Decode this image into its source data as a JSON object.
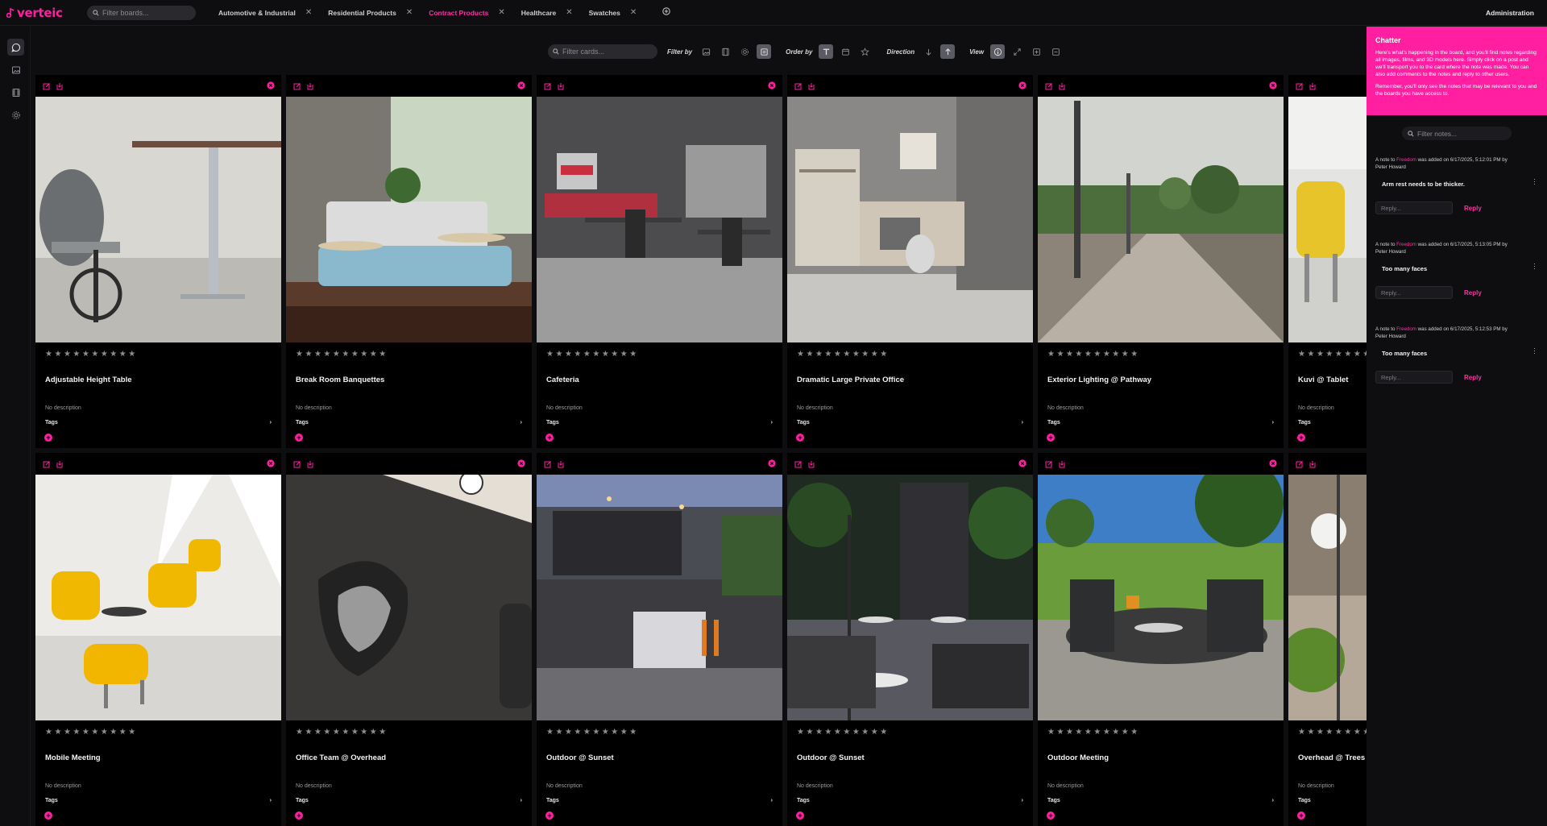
{
  "app": {
    "logo_text": "verteic",
    "brand_color": "#ff1fa0",
    "board_search_placeholder": "Filter boards...",
    "admin_label": "Administration"
  },
  "tabs": [
    {
      "label": "Automotive & Industrial",
      "active": false
    },
    {
      "label": "Residential Products",
      "active": false
    },
    {
      "label": "Contract Products",
      "active": true
    },
    {
      "label": "Healthcare",
      "active": false
    },
    {
      "label": "Swatches",
      "active": false
    }
  ],
  "toolbar": {
    "card_search_placeholder": "Filter cards...",
    "filter_by": "Filter by",
    "order_by": "Order by",
    "direction": "Direction",
    "view": "View"
  },
  "cards": [
    {
      "title": "Adjustable Height Table",
      "description": "No description",
      "tags_label": "Tags",
      "rating": 0
    },
    {
      "title": "Break Room Banquettes",
      "description": "No description",
      "tags_label": "Tags",
      "rating": 0
    },
    {
      "title": "Cafeteria",
      "description": "No description",
      "tags_label": "Tags",
      "rating": 0
    },
    {
      "title": "Dramatic Large Private Office",
      "description": "No description",
      "tags_label": "Tags",
      "rating": 0
    },
    {
      "title": "Exterior Lighting @ Pathway",
      "description": "No description",
      "tags_label": "Tags",
      "rating": 0
    },
    {
      "title": "Kuvi @ Tablet",
      "description": "No description",
      "tags_label": "Tags",
      "rating": 0
    },
    {
      "title": "Mobile Meeting",
      "description": "No description",
      "tags_label": "Tags",
      "rating": 0
    },
    {
      "title": "Office Team @ Overhead",
      "description": "No description",
      "tags_label": "Tags",
      "rating": 0
    },
    {
      "title": "Outdoor @ Sunset",
      "description": "No description",
      "tags_label": "Tags",
      "rating": 0
    },
    {
      "title": "Outdoor @ Sunset",
      "description": "No description",
      "tags_label": "Tags",
      "rating": 0
    },
    {
      "title": "Outdoor Meeting",
      "description": "No description",
      "tags_label": "Tags",
      "rating": 0
    },
    {
      "title": "Overhead @ Trees C",
      "description": "No description",
      "tags_label": "Tags",
      "rating": 0
    }
  ],
  "chatter": {
    "title": "Chatter",
    "intro": "Here's what's happening in the board, and you'll find notes regarding all images, films, and 3D models here. Simply click on a post and we'll transport you to the card where the note was made. You can also add comments to the notes and reply to other users.",
    "remember": "Remember, you'll only see the notes that may be relevant to you and the boards you have access to.",
    "search_placeholder": "Filter notes...",
    "notes": [
      {
        "prefix": "A note to",
        "target": "Freedom",
        "suffix": "was added on 6/17/2025, 5:12:01 PM by",
        "author": "Peter Howard",
        "body": "Arm rest needs to be thicker.",
        "reply_placeholder": "Reply...",
        "reply_label": "Reply"
      },
      {
        "prefix": "A note to",
        "target": "Freedom",
        "suffix": "was added on 6/17/2025, 5:13:05 PM by",
        "author": "Peter Howard",
        "body": "Too many faces",
        "reply_placeholder": "Reply...",
        "reply_label": "Reply"
      },
      {
        "prefix": "A note to",
        "target": "Freedom",
        "suffix": "was added on 6/17/2025, 5:12:53 PM by",
        "author": "Peter Howard",
        "body": "Too many faces",
        "reply_placeholder": "Reply...",
        "reply_label": "Reply"
      }
    ]
  }
}
